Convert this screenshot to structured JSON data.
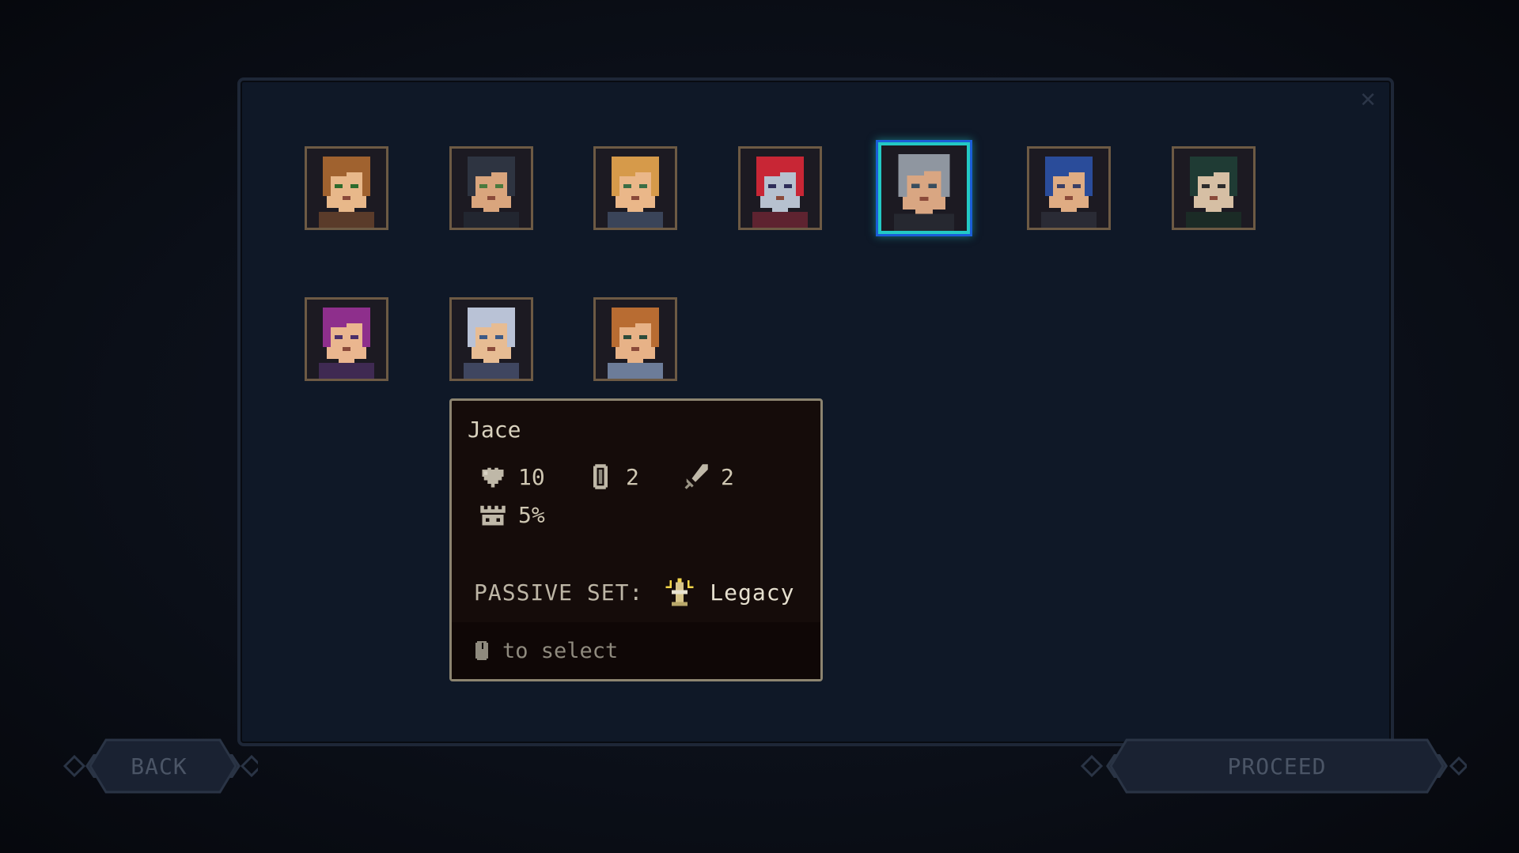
{
  "portraits": [
    {
      "name": "portrait-1",
      "hair": "#a0622f",
      "skin": "#e8b88a",
      "eyes": "#2e6b2c",
      "cloth": "#5a3b2a"
    },
    {
      "name": "portrait-2",
      "hair": "#2e3441",
      "skin": "#d9a57d",
      "eyes": "#4b7a3e",
      "cloth": "#222630"
    },
    {
      "name": "portrait-3",
      "hair": "#d69a4a",
      "skin": "#eab789",
      "eyes": "#3b6e45",
      "cloth": "#3a4459"
    },
    {
      "name": "portrait-4",
      "hair": "#c82635",
      "skin": "#b6c1cf",
      "eyes": "#2e2e5a",
      "cloth": "#5e2330"
    },
    {
      "name": "portrait-5",
      "hair": "#8f96a0",
      "skin": "#d9a682",
      "eyes": "#394d5e",
      "cloth": "#262830",
      "selected": true
    },
    {
      "name": "portrait-6",
      "hair": "#2a4c9a",
      "skin": "#dfac83",
      "eyes": "#3a3f66",
      "cloth": "#2a2b35"
    },
    {
      "name": "portrait-7",
      "hair": "#1f3b34",
      "skin": "#d6bfa4",
      "eyes": "#2c2c2c",
      "cloth": "#1b2b26"
    },
    {
      "name": "portrait-8",
      "hair": "#8e2f8c",
      "skin": "#eab68f",
      "eyes": "#4a2e6a",
      "cloth": "#3f2a52"
    },
    {
      "name": "portrait-9",
      "hair": "#b9c2d6",
      "skin": "#e7bc93",
      "eyes": "#3d5a86",
      "cloth": "#3f4660"
    },
    {
      "name": "portrait-10",
      "hair": "#b86c32",
      "skin": "#e7b287",
      "eyes": "#2d4c3b",
      "cloth": "#6c7c99"
    }
  ],
  "tooltip": {
    "name": "Jace",
    "health": "10",
    "armor": "2",
    "attack": "2",
    "crit": "5%",
    "passive_label": "PASSIVE SET:",
    "passive_value": "Legacy",
    "hint": "to select"
  },
  "buttons": {
    "back": "BACK",
    "proceed": "PROCEED"
  },
  "colors": {
    "selected_border": "#23c9c4",
    "tooltip_border": "#8c8470"
  }
}
